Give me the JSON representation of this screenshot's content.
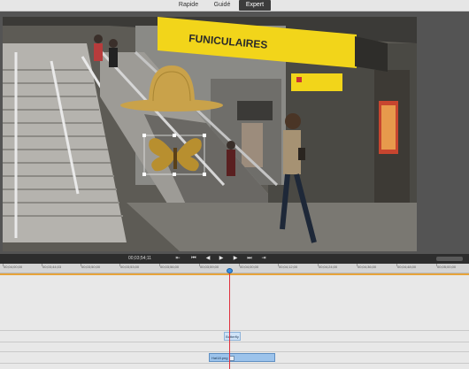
{
  "mode_tabs": [
    {
      "label": "Rapide"
    },
    {
      "label": "Guidé"
    },
    {
      "label": "Expert",
      "active": true
    }
  ],
  "video": {
    "sign_text": "FUNICULAIRES",
    "colors": {
      "sign_yellow": "#f2d51a",
      "hat": "#c9a24a",
      "butterfly": "#b88f2f"
    }
  },
  "transport": {
    "timecode": "00;03;54;11",
    "buttons": [
      {
        "name": "go-to-start-icon",
        "glyph": "⇤"
      },
      {
        "name": "previous-edit-icon",
        "glyph": "⏮"
      },
      {
        "name": "step-back-icon",
        "glyph": "◀"
      },
      {
        "name": "play-icon",
        "glyph": "▶"
      },
      {
        "name": "step-forward-icon",
        "glyph": "▶"
      },
      {
        "name": "next-edit-icon",
        "glyph": "⏭"
      },
      {
        "name": "go-to-end-icon",
        "glyph": "⇥"
      }
    ]
  },
  "ruler": {
    "ticks": [
      "00;04;00;00",
      "00;03;44;03",
      "00;03;50;00",
      "00;03;53;00",
      "00;03;56;00",
      "00;03;59;00",
      "00;04;00;00",
      "00;04;12;00",
      "00;04;24;00",
      "00;04;36;00",
      "00;04;48;00",
      "00;05;00;00"
    ]
  },
  "clips": {
    "butterfly": "Butterfly",
    "hat": "Hat18.png"
  },
  "accent_colors": {
    "playhead": "#e0303d",
    "work_area": "#e7a33a",
    "clip": "#9cc3eb"
  }
}
